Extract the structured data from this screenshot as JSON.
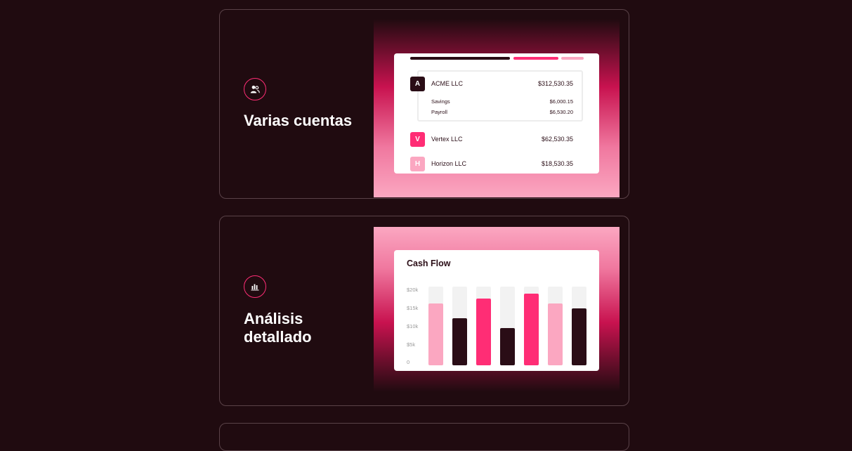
{
  "features": [
    {
      "icon": "users-icon",
      "title": "Varias cuentas",
      "accounts_visual": {
        "accounts": [
          {
            "badge": "A",
            "name": "ACME LLC",
            "amount": "$312,530.35",
            "badge_color": "#2a0d16",
            "sub_accounts": [
              {
                "name": "Savings",
                "amount": "$6,000.15"
              },
              {
                "name": "Payroll",
                "amount": "$6,530.20"
              }
            ]
          },
          {
            "badge": "V",
            "name": "Vertex LLC",
            "amount": "$62,530.35",
            "badge_color": "#ff2d75"
          },
          {
            "badge": "H",
            "name": "Horizon LLC",
            "amount": "$18,530.35",
            "badge_color": "#fba7c1"
          }
        ]
      }
    },
    {
      "icon": "bar-chart-icon",
      "title_line1": "Análisis",
      "title_line2": "detallado"
    }
  ],
  "colors": {
    "background": "#200b10",
    "accent": "#ff2d75",
    "accent_light": "#fba7c1",
    "dark": "#2a0d16"
  },
  "chart_data": {
    "type": "bar",
    "title": "Cash Flow",
    "y_ticks": [
      "$20k",
      "$15k",
      "$10k",
      "$5k",
      "0"
    ],
    "ylim": [
      0,
      20
    ],
    "series": [
      {
        "values": [
          15.8,
          12,
          17,
          9.5,
          18.3,
          15.8,
          14.4
        ]
      }
    ],
    "bar_colors": [
      "#fba7c1",
      "#2a0d16",
      "#ff2d75",
      "#2a0d16",
      "#ff2d75",
      "#fba7c1",
      "#2a0d16"
    ]
  }
}
